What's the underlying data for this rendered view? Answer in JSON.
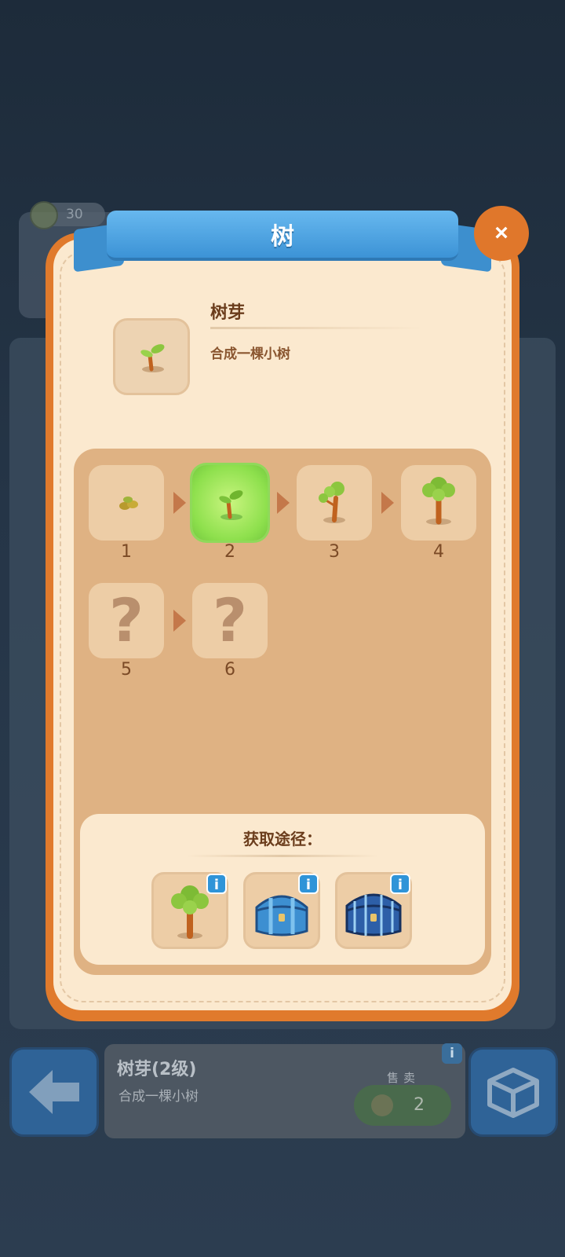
{
  "background": {
    "coin_count": "30"
  },
  "modal": {
    "title": "树",
    "close_label": "×",
    "item": {
      "name": "树芽",
      "description": "合成一棵小树",
      "icon": "sprout-icon"
    },
    "chain": [
      {
        "level": "1",
        "icon": "seed-icon",
        "unlocked": true,
        "selected": false
      },
      {
        "level": "2",
        "icon": "sprout-icon",
        "unlocked": true,
        "selected": true
      },
      {
        "level": "3",
        "icon": "sapling-icon",
        "unlocked": true,
        "selected": false
      },
      {
        "level": "4",
        "icon": "small-tree-icon",
        "unlocked": true,
        "selected": false
      },
      {
        "level": "5",
        "icon": "unknown-icon",
        "unlocked": false,
        "selected": false
      },
      {
        "level": "6",
        "icon": "unknown-icon",
        "unlocked": false,
        "selected": false
      }
    ],
    "unknown_mark": "?",
    "sources": {
      "title": "获取途径：",
      "items": [
        {
          "icon": "tree-icon",
          "info": "i"
        },
        {
          "icon": "blue-chest-icon",
          "info": "i"
        },
        {
          "icon": "dark-blue-chest-icon",
          "info": "i"
        }
      ]
    }
  },
  "bottom_bar": {
    "item_title": "树芽(2级)",
    "item_description": "合成一棵小树",
    "sell_label": "售卖",
    "sell_price": "2",
    "info_label": "i"
  },
  "colors": {
    "modal_orange": "#e07a2c",
    "ribbon_blue": "#3c93d6",
    "selected_green": "#8ee04d",
    "panel_tan": "#dfb283"
  }
}
